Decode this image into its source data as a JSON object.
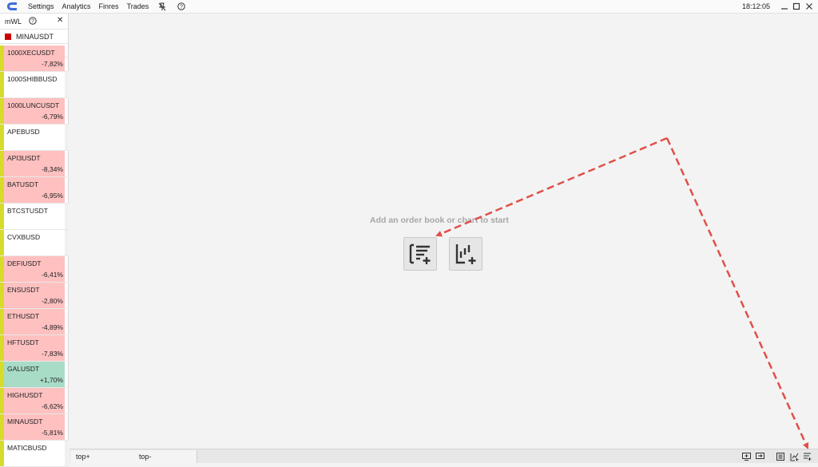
{
  "app": {
    "logo": "app-logo-icon",
    "menu": [
      "Settings",
      "Analytics",
      "Finres",
      "Trades"
    ],
    "menu_icons": [
      "pin-off-icon",
      "help-icon"
    ],
    "clock": "18:12:05"
  },
  "watchlist": {
    "title": "mWL",
    "selected_symbol": "MINAUSDT",
    "selected_color": "#cc0000",
    "rows": [
      {
        "symbol": "1000XECUSDT",
        "change": "-7,82%",
        "state": "neg"
      },
      {
        "symbol": "1000SHIBBUSD",
        "change": "",
        "state": "neutral"
      },
      {
        "symbol": "1000LUNCUSDT",
        "change": "-6,79%",
        "state": "neg"
      },
      {
        "symbol": "APEBUSD",
        "change": "",
        "state": "neutral"
      },
      {
        "symbol": "API3USDT",
        "change": "-8,34%",
        "state": "neg"
      },
      {
        "symbol": "BATUSDT",
        "change": "-6,95%",
        "state": "neg"
      },
      {
        "symbol": "BTCSTUSDT",
        "change": "",
        "state": "neutral"
      },
      {
        "symbol": "CVXBUSD",
        "change": "",
        "state": "neutral"
      },
      {
        "symbol": "DEFIUSDT",
        "change": "-6,41%",
        "state": "neg"
      },
      {
        "symbol": "ENSUSDT",
        "change": "-2,80%",
        "state": "neg"
      },
      {
        "symbol": "ETHUSDT",
        "change": "-4,89%",
        "state": "neg"
      },
      {
        "symbol": "HFTUSDT",
        "change": "-7,83%",
        "state": "neg"
      },
      {
        "symbol": "GALUSDT",
        "change": "+1,70%",
        "state": "pos"
      },
      {
        "symbol": "HIGHUSDT",
        "change": "-6,62%",
        "state": "neg"
      },
      {
        "symbol": "MINAUSDT",
        "change": "-5,81%",
        "state": "neg"
      },
      {
        "symbol": "MATICBUSD",
        "change": "",
        "state": "neutral"
      }
    ]
  },
  "main": {
    "hint": "Add an order book or chart to start"
  },
  "bottom": {
    "tabs": [
      "top+",
      "top-"
    ]
  },
  "colors": {
    "negative": "#ffc0c0",
    "positive": "#a8dcc7",
    "marker": "#d7db2a",
    "arrow": "#e0504a"
  }
}
